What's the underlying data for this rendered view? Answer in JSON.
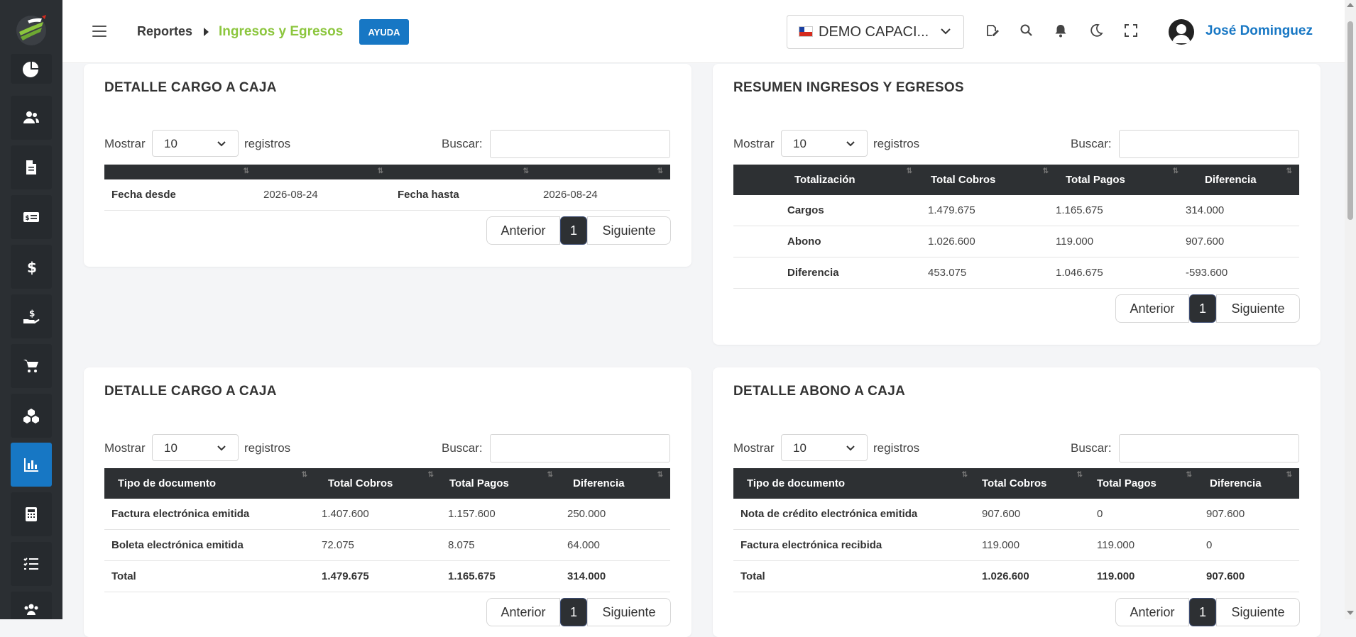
{
  "breadcrumb": {
    "root": "Reportes",
    "current": "Ingresos y Egresos"
  },
  "help_label": "AYUDA",
  "company_selector": {
    "value": "DEMO CAPACI..."
  },
  "user": {
    "name": "José Dominguez"
  },
  "colors": {
    "accent": "#1777c4",
    "brand_green": "#8cc63e",
    "sidebar": "#2b2f33",
    "table_header": "#2d3033"
  },
  "sidebar": {
    "items": [
      {
        "icon": "pie-chart-icon"
      },
      {
        "icon": "users-icon"
      },
      {
        "icon": "document-icon"
      },
      {
        "icon": "money-card-icon"
      },
      {
        "icon": "dollar-icon"
      },
      {
        "icon": "hand-dollar-icon"
      },
      {
        "icon": "cart-icon"
      },
      {
        "icon": "boxes-icon"
      },
      {
        "icon": "bar-chart-icon",
        "active": true
      },
      {
        "icon": "calculator-icon"
      },
      {
        "icon": "list-check-icon"
      },
      {
        "icon": "group-icon"
      }
    ]
  },
  "header_icons": [
    "signature-icon",
    "search-icon",
    "bell-icon",
    "moon-icon",
    "fullscreen-icon"
  ],
  "controls": {
    "show": "Mostrar",
    "records": "registros",
    "search": "Buscar:",
    "page_size": "10"
  },
  "pager": {
    "prev": "Anterior",
    "page": "1",
    "next": "Siguiente"
  },
  "card1": {
    "title": "DETALLE CARGO A CAJA",
    "row": {
      "from_label": "Fecha desde",
      "from_value": "2026-08-24",
      "to_label": "Fecha hasta",
      "to_value": "2026-08-24"
    }
  },
  "card2": {
    "title": "RESUMEN INGRESOS Y EGRESOS",
    "headers": [
      "Totalización",
      "Total Cobros",
      "Total Pagos",
      "Diferencia"
    ],
    "rows": [
      [
        "Cargos",
        "1.479.675",
        "1.165.675",
        "314.000"
      ],
      [
        "Abono",
        "1.026.600",
        "119.000",
        "907.600"
      ],
      [
        "Diferencia",
        "453.075",
        "1.046.675",
        "-593.600"
      ]
    ]
  },
  "card3": {
    "title": "DETALLE CARGO A CAJA",
    "headers": [
      "Tipo de documento",
      "Total Cobros",
      "Total Pagos",
      "Diferencia"
    ],
    "rows": [
      [
        "Factura electrónica emitida",
        "1.407.600",
        "1.157.600",
        "250.000"
      ],
      [
        "Boleta electrónica emitida",
        "72.075",
        "8.075",
        "64.000"
      ],
      [
        "Total",
        "1.479.675",
        "1.165.675",
        "314.000"
      ]
    ]
  },
  "card4": {
    "title": "DETALLE ABONO A CAJA",
    "headers": [
      "Tipo de documento",
      "Total Cobros",
      "Total Pagos",
      "Diferencia"
    ],
    "rows": [
      [
        "Nota de crédito electrónica emitida",
        "907.600",
        "0",
        "907.600"
      ],
      [
        "Factura electrónica recibida",
        "119.000",
        "119.000",
        "0"
      ],
      [
        "Total",
        "1.026.600",
        "119.000",
        "907.600"
      ]
    ]
  }
}
